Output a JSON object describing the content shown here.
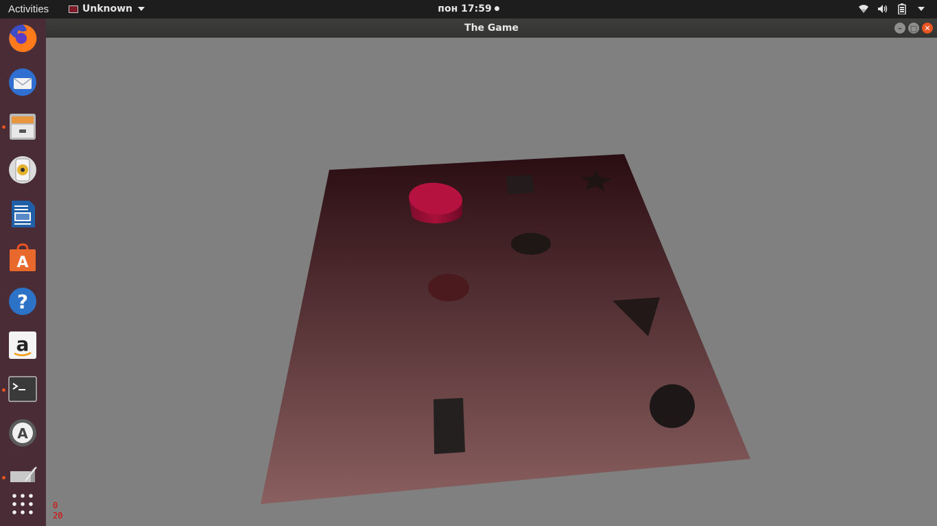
{
  "topbar": {
    "activities": "Activities",
    "app_name": "Unknown",
    "clock": "пон 17:59",
    "tray": [
      "wifi-icon",
      "volume-icon",
      "battery-icon",
      "system-menu-icon"
    ]
  },
  "dock": {
    "items": [
      {
        "name": "firefox",
        "running": false
      },
      {
        "name": "thunderbird",
        "running": false
      },
      {
        "name": "files",
        "running": true
      },
      {
        "name": "rhythmbox",
        "running": false
      },
      {
        "name": "libreoffice-writer",
        "running": false
      },
      {
        "name": "ubuntu-software",
        "running": false
      },
      {
        "name": "help",
        "running": false
      },
      {
        "name": "amazon",
        "running": false
      },
      {
        "name": "terminal",
        "running": true
      },
      {
        "name": "software-updater",
        "running": false
      },
      {
        "name": "the-game",
        "running": true
      },
      {
        "name": "show-applications",
        "running": false
      }
    ]
  },
  "window": {
    "title": "The Game",
    "controls": [
      "minimize",
      "maximize",
      "close"
    ]
  },
  "game": {
    "board_color_far": "#2a0d12",
    "board_color_near": "#8a5f5f",
    "background": "#808080",
    "objects": [
      {
        "shape": "cylinder",
        "color": "#b5123f"
      },
      {
        "shape": "square-hole",
        "color": "#241c1c"
      },
      {
        "shape": "star-hole",
        "color": "#1f1414"
      },
      {
        "shape": "ellipse-hole",
        "color": "#1f1616"
      },
      {
        "shape": "ellipse-hole",
        "color": "#4a1a1e"
      },
      {
        "shape": "triangle-hole",
        "color": "#221818"
      },
      {
        "shape": "rectangle-hole",
        "color": "#252020"
      },
      {
        "shape": "ellipse-hole",
        "color": "#1e1717"
      }
    ]
  },
  "hud": {
    "line1": "0",
    "line2": "20"
  }
}
